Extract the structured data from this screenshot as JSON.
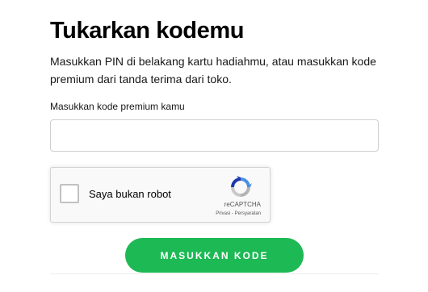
{
  "heading": "Tukarkan kodemu",
  "description": "Masukkan PIN di belakang kartu hadiahmu, atau masukkan kode premium dari tanda terima dari toko.",
  "code_field": {
    "label": "Masukkan kode premium kamu",
    "value": "",
    "placeholder": ""
  },
  "recaptcha": {
    "checkbox_label": "Saya bukan robot",
    "brand": "reCAPTCHA",
    "privacy_link": "Privasi",
    "separator": " - ",
    "terms_link": "Persyaratan",
    "logo_icon": "recaptcha-logo-icon"
  },
  "submit_button": "MASUKKAN KODE",
  "colors": {
    "accent": "#1db954",
    "text": "#181818",
    "heading": "#000000",
    "recaptcha_blue": "#1c3aa9",
    "recaptcha_light_blue": "#4a90e2"
  }
}
